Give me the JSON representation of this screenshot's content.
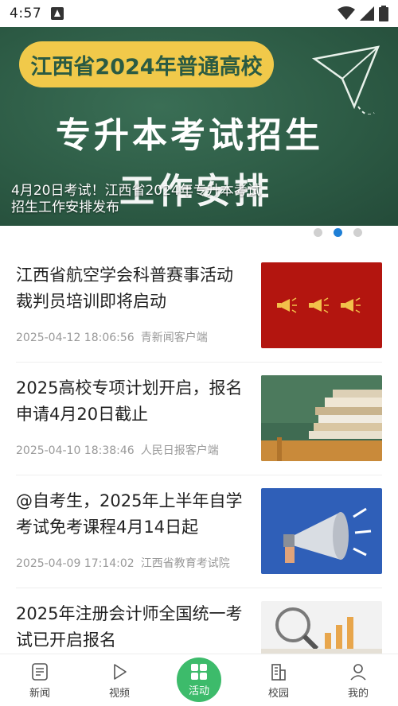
{
  "status_bar": {
    "time": "4:57"
  },
  "banner": {
    "pill_text": "江西省2024年普通高校",
    "headline_line1": "专升本考试招生",
    "headline_line2": "工作安排",
    "caption": "4月20日考试！江西省2024年专升本考试招生工作安排发布",
    "dots": 3,
    "active_dot": 1
  },
  "news": [
    {
      "title": "江西省航空学会科普赛事活动裁判员培训即将启动",
      "date": "2025-04-12 18:06:56",
      "source": "青新闻客户端",
      "thumb": "red-banner-horns"
    },
    {
      "title": "2025高校专项计划开启，报名申请4月20日截止",
      "date": "2025-04-10 18:38:46",
      "source": "人民日报客户端",
      "thumb": "books-chalkboard"
    },
    {
      "title": "@自考生，2025年上半年自学考试免考课程4月14日起",
      "date": "2025-04-09 17:14:02",
      "source": "江西省教育考试院",
      "thumb": "megaphone-blue"
    },
    {
      "title": "2025年注册会计师全国统一考试已开启报名",
      "date": "",
      "source": "",
      "thumb": "magnifier-coins"
    }
  ],
  "bottom_nav": [
    {
      "label": "新闻",
      "icon": "news-icon",
      "active": false
    },
    {
      "label": "视频",
      "icon": "play-icon",
      "active": false
    },
    {
      "label": "活动",
      "icon": "grid-icon",
      "active": true
    },
    {
      "label": "校园",
      "icon": "building-icon",
      "active": false
    },
    {
      "label": "我的",
      "icon": "profile-icon",
      "active": false
    }
  ],
  "colors": {
    "accent": "#3dbb6b",
    "dot_active": "#1e7fd6",
    "banner_bg": "#2e5d47",
    "pill": "#f1c94a"
  }
}
